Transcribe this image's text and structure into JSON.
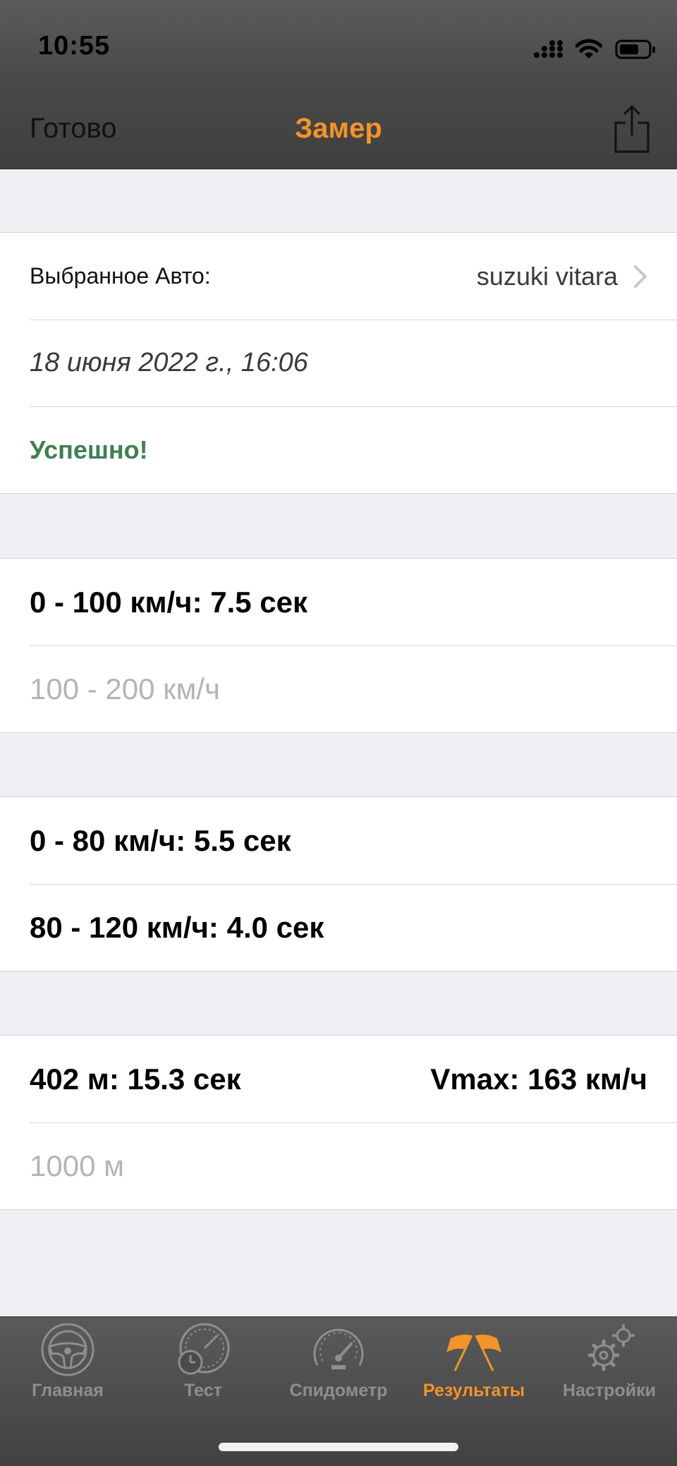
{
  "status_bar": {
    "time": "10:55",
    "icons": [
      "cellular-signal-icon",
      "wifi-icon",
      "battery-icon"
    ]
  },
  "nav": {
    "done_label": "Готово",
    "title": "Замер",
    "share_icon": "share-icon"
  },
  "info_section": {
    "car_label": "Выбранное Авто:",
    "car_value": "suzuki vitara",
    "date": "18 июня 2022 г., 16:06",
    "status": "Успешно!"
  },
  "accel_section": {
    "row_0_100": "0 - 100 км/ч: 7.5 сек",
    "row_100_200": "100 - 200 км/ч"
  },
  "mid_section": {
    "row_0_80": "0 - 80 км/ч: 5.5 сек",
    "row_80_120": "80 - 120 км/ч: 4.0 сек"
  },
  "distance_section": {
    "row_402": "402 м: 15.3 сек",
    "vmax": "Vmax: 163 км/ч",
    "row_1000": "1000 м"
  },
  "tabbar": {
    "tabs": [
      {
        "label": "Главная",
        "icon": "steering-wheel-icon",
        "active": false
      },
      {
        "label": "Тест",
        "icon": "stopwatch-gauge-icon",
        "active": false
      },
      {
        "label": "Спидометр",
        "icon": "speedometer-icon",
        "active": false
      },
      {
        "label": "Результаты",
        "icon": "racing-flags-icon",
        "active": true
      },
      {
        "label": "Настройки",
        "icon": "gears-icon",
        "active": false
      }
    ]
  },
  "colors": {
    "accent": "#f4932a",
    "success": "#3f7f52",
    "muted_text": "#b4b4b4",
    "inactive_tab": "#8e8e8e",
    "background": "#efeff4"
  }
}
